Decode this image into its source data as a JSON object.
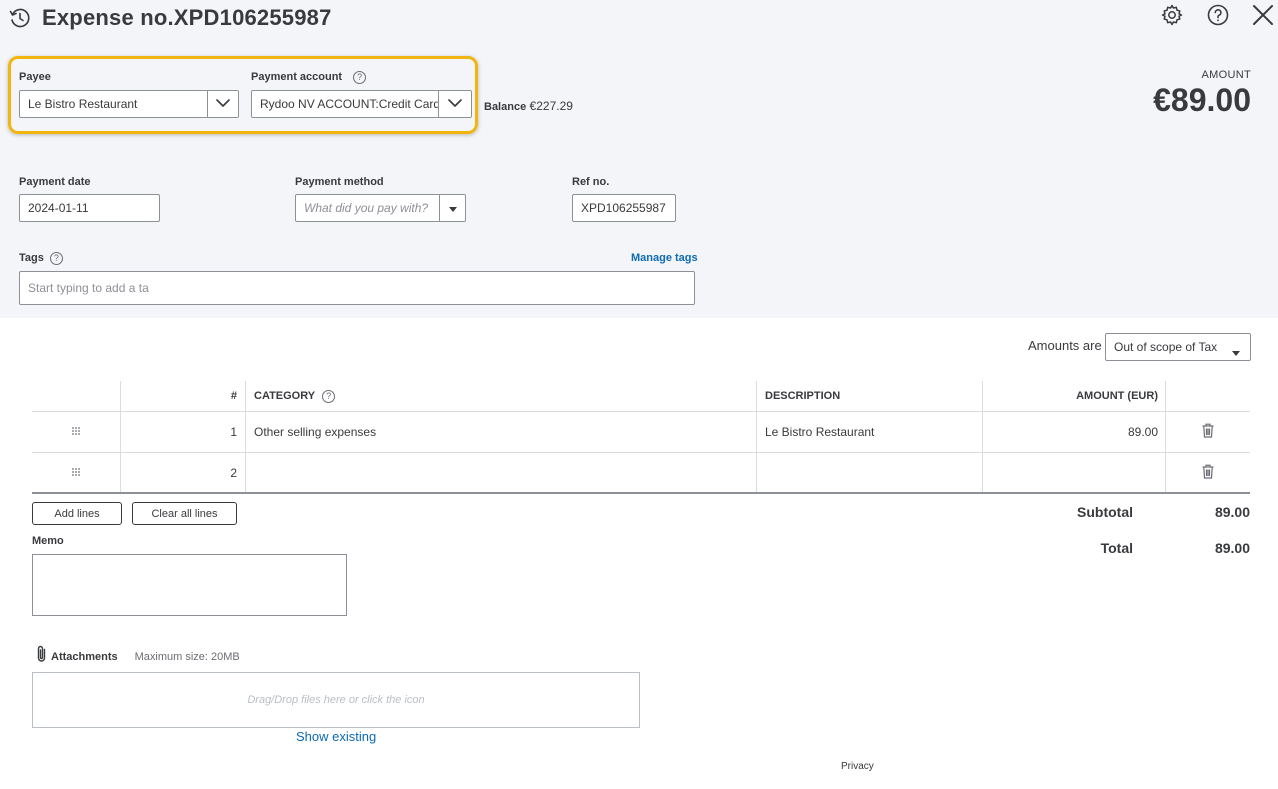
{
  "header": {
    "title": "Expense no.XPD106255987"
  },
  "payee": {
    "label": "Payee",
    "value": "Le Bistro Restaurant"
  },
  "payment_account": {
    "label": "Payment account",
    "value": "Rydoo NV ACCOUNT:Credit Card",
    "balance_label": "Balance",
    "balance_value": "€227.29"
  },
  "amount": {
    "label": "AMOUNT",
    "value": "€89.00"
  },
  "payment_date": {
    "label": "Payment date",
    "value": "2024-01-11"
  },
  "payment_method": {
    "label": "Payment method",
    "placeholder": "What did you pay with?"
  },
  "ref_no": {
    "label": "Ref no.",
    "value": "XPD106255987"
  },
  "tags": {
    "label": "Tags",
    "manage_link": "Manage tags",
    "placeholder": "Start typing to add a ta"
  },
  "amounts_are": {
    "label": "Amounts are",
    "value": "Out of scope of Tax"
  },
  "table": {
    "headers": {
      "num": "#",
      "category": "CATEGORY",
      "description": "DESCRIPTION",
      "amount": "AMOUNT (EUR)"
    },
    "rows": [
      {
        "num": "1",
        "category": "Other selling expenses",
        "description": "Le Bistro Restaurant",
        "amount": "89.00"
      },
      {
        "num": "2",
        "category": "",
        "description": "",
        "amount": ""
      }
    ]
  },
  "buttons": {
    "add_lines": "Add lines",
    "clear_all_lines": "Clear all lines"
  },
  "totals": {
    "subtotal_label": "Subtotal",
    "subtotal_value": "89.00",
    "total_label": "Total",
    "total_value": "89.00"
  },
  "memo": {
    "label": "Memo"
  },
  "attachments": {
    "label": "Attachments",
    "max_size": "Maximum size: 20MB",
    "drop_text": "Drag/Drop files here or click the icon",
    "show_existing": "Show existing"
  },
  "footer": {
    "privacy": "Privacy"
  }
}
